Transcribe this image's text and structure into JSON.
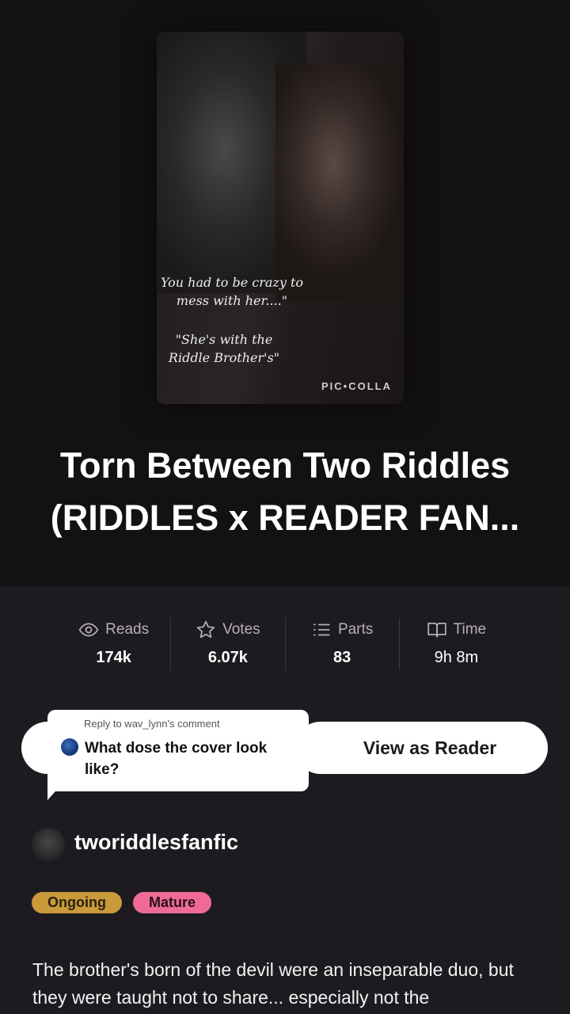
{
  "cover": {
    "quote_line1": "You had to be crazy to mess with her....\"",
    "quote_line2": "\"She's with the Riddle Brother's\"",
    "watermark": "PIC•COLLA"
  },
  "story": {
    "title": "Torn Between Two Riddles (RIDDLES x READER FAN..."
  },
  "stats": [
    {
      "icon": "eye-icon",
      "label": "Reads",
      "value": "174k"
    },
    {
      "icon": "star-icon",
      "label": "Votes",
      "value": "6.07k"
    },
    {
      "icon": "list-icon",
      "label": "Parts",
      "value": "83"
    },
    {
      "icon": "book-icon",
      "label": "Time",
      "value": "9h 8m"
    }
  ],
  "actions": {
    "view_as_reader": "View as Reader"
  },
  "reply_overlay": {
    "reply_to": "Reply to wav_lynn's comment",
    "comment": "What dose the cover look like?"
  },
  "author": {
    "name": "tworiddlesfanfic"
  },
  "tags": [
    "Ongoing",
    "Mature"
  ],
  "description": "The brother's born of the devil were an inseparable duo, but they were taught not to share... especially not the"
}
